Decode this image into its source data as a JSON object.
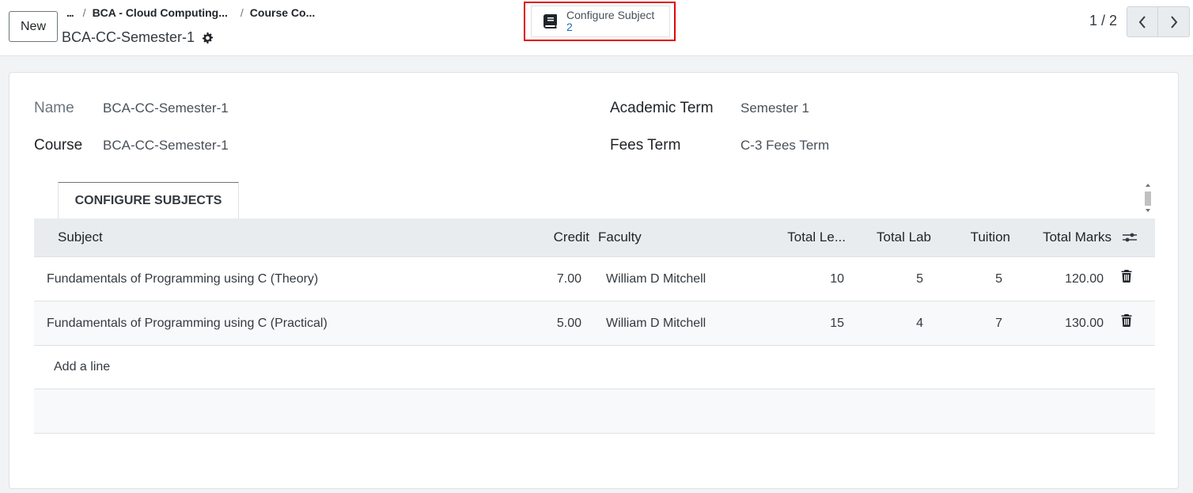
{
  "control_panel": {
    "new_label": "New",
    "breadcrumb": {
      "dots": "...",
      "crumbs": [
        "BCA - Cloud Computing...",
        "Course Co..."
      ]
    },
    "record_title": "BCA-CC-Semester-1",
    "smart_button": {
      "label": "Configure Subject",
      "count": "2",
      "icon": "book-icon"
    },
    "pager": "1 / 2"
  },
  "form": {
    "fields": {
      "name_label": "Name",
      "name_value": "BCA-CC-Semester-1",
      "course_label": "Course",
      "course_value": "BCA-CC-Semester-1",
      "academic_term_label": "Academic Term",
      "academic_term_value": "Semester 1",
      "fees_term_label": "Fees Term",
      "fees_term_value": "C-3 Fees Term"
    },
    "tab_label": "CONFIGURE SUBJECTS",
    "table": {
      "headers": {
        "subject": "Subject",
        "credit": "Credit",
        "faculty": "Faculty",
        "total_lecture": "Total Le...",
        "total_lab": "Total Lab",
        "tuition": "Tuition",
        "total_marks": "Total Marks"
      },
      "rows": [
        {
          "subject": "Fundamentals of Programming using C (Theory)",
          "credit": "7.00",
          "faculty": "William D Mitchell",
          "total_lecture": "10",
          "total_lab": "5",
          "tuition": "5",
          "total_marks": "120.00"
        },
        {
          "subject": "Fundamentals of Programming using C (Practical)",
          "credit": "5.00",
          "faculty": "William D Mitchell",
          "total_lecture": "15",
          "total_lab": "4",
          "tuition": "7",
          "total_marks": "130.00"
        }
      ],
      "add_line": "Add a line"
    }
  },
  "colors": {
    "highlight_border": "#e00000",
    "count_link": "#1f6bb3",
    "header_bg": "#e9ecef"
  }
}
